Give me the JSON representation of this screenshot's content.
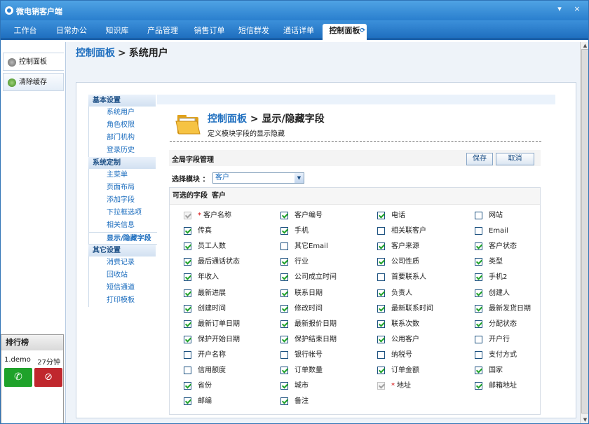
{
  "app": {
    "title": "微电销客户端",
    "minimize": "▾",
    "close": "×"
  },
  "nav": {
    "tabs": [
      {
        "label": "工作台"
      },
      {
        "label": "日常办公"
      },
      {
        "label": "知识库"
      },
      {
        "label": "产品管理"
      },
      {
        "label": "销售订单"
      },
      {
        "label": "短信群发"
      },
      {
        "label": "通话详单"
      },
      {
        "label": "控制面板",
        "active": true
      }
    ]
  },
  "sidebar": {
    "tabs": [
      {
        "label": "控制面板",
        "icon": "gear-icon"
      },
      {
        "label": "清除缓存",
        "icon": "clear-cache-icon"
      }
    ]
  },
  "ranking": {
    "title": "排行榜",
    "entries": [
      {
        "user": "1.demo",
        "duration": "27分钟"
      }
    ],
    "call_icon": "phone-answer-icon",
    "hangup_icon": "phone-hangup-icon",
    "call_color": "#1fa22a",
    "hangup_color": "#c0272d"
  },
  "breadcrumb": {
    "root": "控制面板",
    "sep": ">",
    "current": "系统用户"
  },
  "submenu": {
    "groups": [
      {
        "title": "基本设置",
        "items": [
          "系统用户",
          "角色权限",
          "部门机构",
          "登录历史"
        ]
      },
      {
        "title": "系统定制",
        "items": [
          "主菜单",
          "页面布局",
          "添加字段",
          "下拉框选项",
          "相关信息",
          "显示/隐藏字段"
        ]
      },
      {
        "title": "其它设置",
        "items": [
          "消费记录",
          "回收站",
          "短信通道",
          "打印模板"
        ]
      }
    ],
    "active": "显示/隐藏字段"
  },
  "page": {
    "title_root": "控制面板",
    "title_sep": ">",
    "title_current": "显示/隐藏字段",
    "desc": "定义模块字段的显示隐藏"
  },
  "global": {
    "label": "全局字段管理",
    "save": "保存",
    "cancel": "取消"
  },
  "module": {
    "label": "选择模块 ：",
    "value": "客户"
  },
  "fields": {
    "header": "可选的字段",
    "module": "客户",
    "items": [
      {
        "label": "客户名称",
        "checked": true,
        "disabled": true,
        "required": true
      },
      {
        "label": "客户编号",
        "checked": true
      },
      {
        "label": "电话",
        "checked": true
      },
      {
        "label": "网站",
        "checked": false
      },
      {
        "label": "传真",
        "checked": true
      },
      {
        "label": "手机",
        "checked": true
      },
      {
        "label": "相关联客户",
        "checked": false
      },
      {
        "label": "Email",
        "checked": false
      },
      {
        "label": "员工人数",
        "checked": true
      },
      {
        "label": "其它Email",
        "checked": false
      },
      {
        "label": "客户来源",
        "checked": true
      },
      {
        "label": "客户状态",
        "checked": true
      },
      {
        "label": "最后通话状态",
        "checked": true
      },
      {
        "label": "行业",
        "checked": true
      },
      {
        "label": "公司性质",
        "checked": true
      },
      {
        "label": "类型",
        "checked": true
      },
      {
        "label": "年收入",
        "checked": true
      },
      {
        "label": "公司成立时间",
        "checked": true
      },
      {
        "label": "首要联系人",
        "checked": false
      },
      {
        "label": "手机2",
        "checked": true
      },
      {
        "label": "最新进展",
        "checked": true
      },
      {
        "label": "联系日期",
        "checked": true
      },
      {
        "label": "负责人",
        "checked": true
      },
      {
        "label": "创建人",
        "checked": true
      },
      {
        "label": "创建时间",
        "checked": true
      },
      {
        "label": "修改时间",
        "checked": true
      },
      {
        "label": "最新联系时间",
        "checked": true
      },
      {
        "label": "最新发货日期",
        "checked": true
      },
      {
        "label": "最新订单日期",
        "checked": true
      },
      {
        "label": "最新报价日期",
        "checked": true
      },
      {
        "label": "联系次数",
        "checked": true
      },
      {
        "label": "分配状态",
        "checked": true
      },
      {
        "label": "保护开始日期",
        "checked": true
      },
      {
        "label": "保护结束日期",
        "checked": true
      },
      {
        "label": "公用客户",
        "checked": true
      },
      {
        "label": "开户行",
        "checked": false
      },
      {
        "label": "开户名称",
        "checked": false
      },
      {
        "label": "银行帐号",
        "checked": false
      },
      {
        "label": "纳税号",
        "checked": false
      },
      {
        "label": "支付方式",
        "checked": false
      },
      {
        "label": "信用额度",
        "checked": false
      },
      {
        "label": "订单数量",
        "checked": true
      },
      {
        "label": "订单金额",
        "checked": true
      },
      {
        "label": "国家",
        "checked": true
      },
      {
        "label": "省份",
        "checked": true
      },
      {
        "label": "城市",
        "checked": true
      },
      {
        "label": "地址",
        "checked": true,
        "disabled": true,
        "required": true
      },
      {
        "label": "邮箱地址",
        "checked": true
      },
      {
        "label": "邮编",
        "checked": true
      },
      {
        "label": "备注",
        "checked": true
      }
    ]
  }
}
